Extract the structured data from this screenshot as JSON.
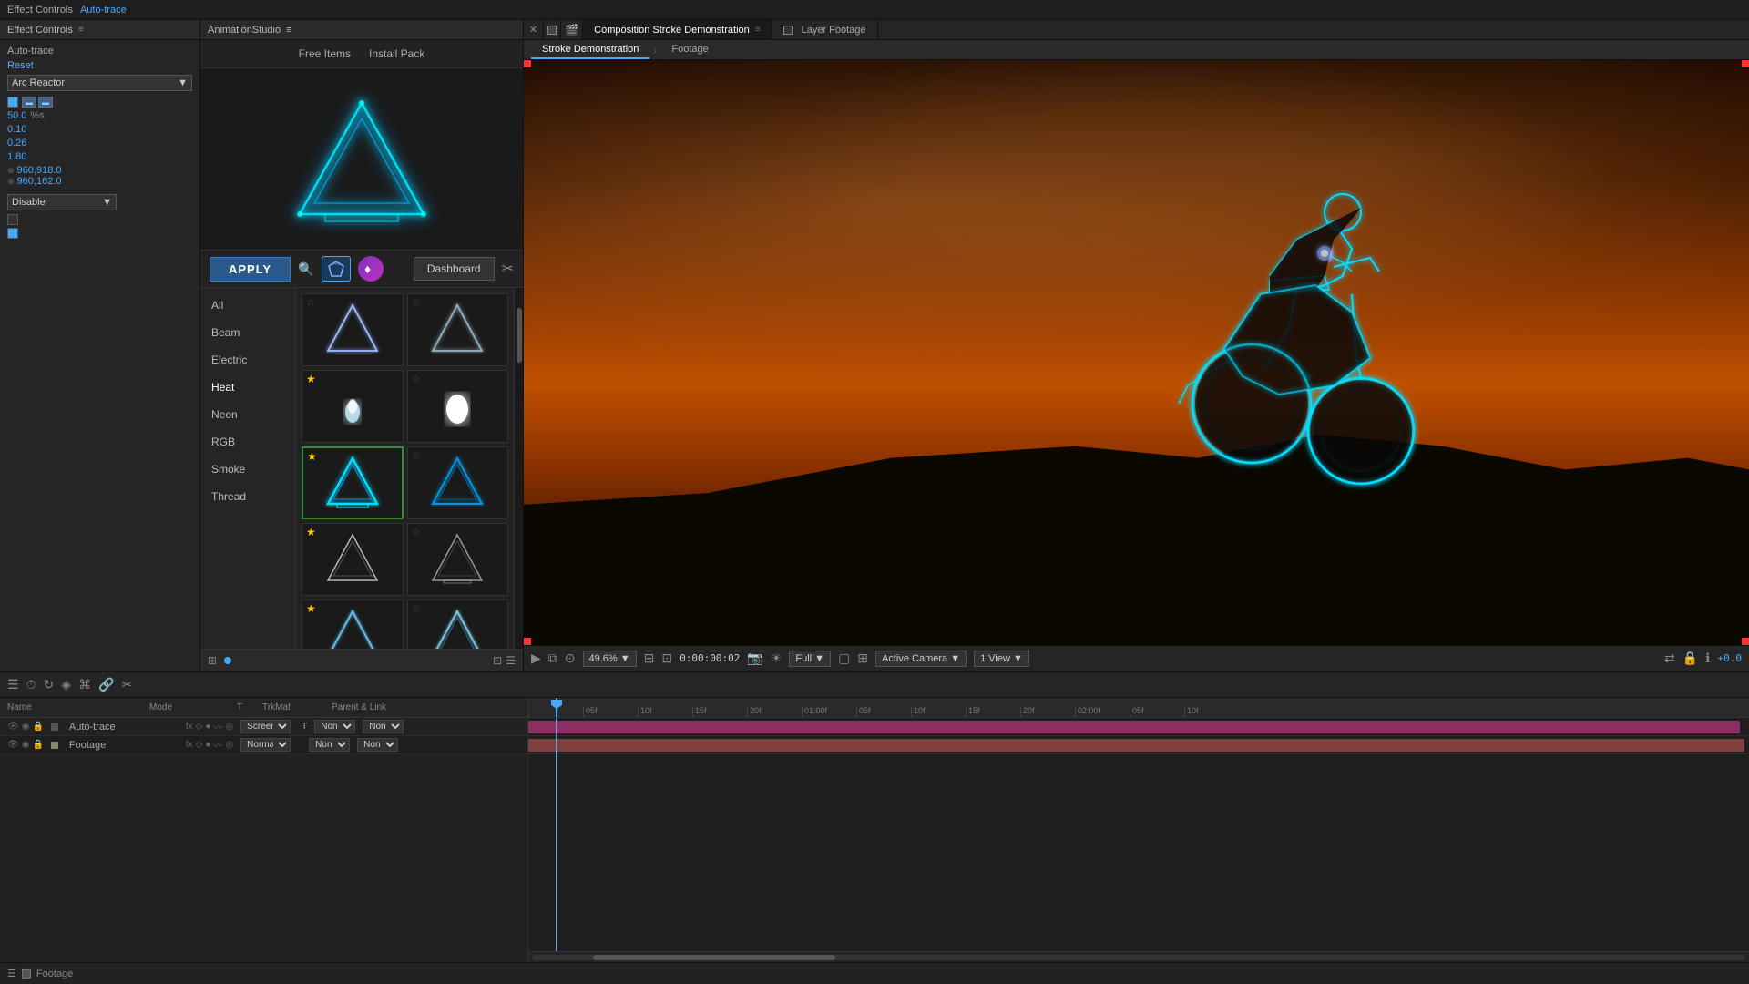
{
  "topBar": {
    "tabs": [
      "Effect Controls",
      "Auto-trace"
    ]
  },
  "effectControls": {
    "title": "Effect Controls",
    "layerName": "Auto-trace",
    "reset": "Reset",
    "preset": "Arc Reactor",
    "values": {
      "percentage": "50.0",
      "percentLabel": "%s",
      "v1": "0.10",
      "v2": "0.26",
      "v3": "1.80",
      "coord1": "960,918.0",
      "coord2": "960,162.0"
    },
    "disable": "Disable"
  },
  "animStudio": {
    "title": "AnimationStudio",
    "menuIcon": "≡",
    "topButtons": [
      "Free Items",
      "Install Pack"
    ],
    "applyLabel": "APPLY",
    "dashboardLabel": "Dashboard",
    "categories": [
      {
        "id": "all",
        "label": "All"
      },
      {
        "id": "beam",
        "label": "Beam"
      },
      {
        "id": "electric",
        "label": "Electric"
      },
      {
        "id": "heat",
        "label": "Heat"
      },
      {
        "id": "neon",
        "label": "Neon"
      },
      {
        "id": "rgb",
        "label": "RGB"
      },
      {
        "id": "smoke",
        "label": "Smoke"
      },
      {
        "id": "thread",
        "label": "Thread"
      }
    ],
    "activeCategory": "heat",
    "presets": [
      {
        "id": 1,
        "starred": true,
        "selected": true
      },
      {
        "id": 2,
        "starred": false,
        "selected": false
      },
      {
        "id": 3,
        "starred": true,
        "selected": false
      },
      {
        "id": 4,
        "starred": false,
        "selected": false
      },
      {
        "id": 5,
        "starred": true,
        "selected": false
      },
      {
        "id": 6,
        "starred": false,
        "selected": false
      },
      {
        "id": 7,
        "starred": true,
        "selected": false
      },
      {
        "id": 8,
        "starred": false,
        "selected": false
      },
      {
        "id": 9,
        "starred": true,
        "selected": false
      },
      {
        "id": 10,
        "starred": false,
        "selected": false
      }
    ]
  },
  "composition": {
    "tabs": [
      {
        "id": "comp",
        "label": "Composition Stroke Demonstration",
        "active": true
      },
      {
        "id": "layer",
        "label": "Layer Footage",
        "active": false
      }
    ],
    "viewTabs": [
      {
        "id": "stroke",
        "label": "Stroke Demonstration",
        "active": true
      },
      {
        "id": "footage",
        "label": "Footage",
        "active": false
      }
    ],
    "zoom": "49.6%",
    "timecode": "0:00:00:02",
    "quality": "Full",
    "camera": "Active Camera",
    "views": "1 View"
  },
  "timeline": {
    "columns": {
      "name": "Name",
      "mode": "Mode",
      "t": "T",
      "trkmat": "TrkMat",
      "parent": "Parent & Link"
    },
    "layers": [
      {
        "name": "Auto-trace",
        "mode": "Screen",
        "modeAlt": "Normal",
        "trkmat": "None",
        "parent": "None"
      },
      {
        "name": "Footage",
        "mode": "",
        "trkmat": "",
        "parent": ""
      }
    ],
    "rulerMarks": [
      "",
      "05f",
      "10f",
      "15f",
      "20f",
      "01:00f",
      "05f",
      "10f",
      "15f",
      "20f",
      "02:00f",
      "05f",
      "10f"
    ]
  },
  "footagePanel": {
    "label": "Footage"
  }
}
